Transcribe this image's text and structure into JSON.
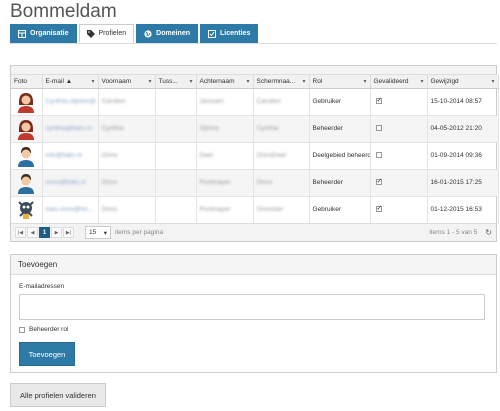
{
  "page": {
    "title": "Bommeldam"
  },
  "tabs": [
    {
      "label": "Organisatie",
      "icon": "table-icon",
      "active": false
    },
    {
      "label": "Profielen",
      "icon": "tags-icon",
      "active": true
    },
    {
      "label": "Domeinen",
      "icon": "globe-icon",
      "active": false
    },
    {
      "label": "Licenties",
      "icon": "checkbox-edit-icon",
      "active": false
    }
  ],
  "grid": {
    "columns": [
      "Foto",
      "E-mail",
      "Voornaam",
      "Tuss...",
      "Achternaam",
      "Schermnaa...",
      "Rol",
      "Gevalideerd",
      "Gewijzigd"
    ],
    "sort_indicator": "▲",
    "rows": [
      {
        "email": "Cynthia.clijsten@...",
        "voornaam": "Carolien",
        "tuss": "",
        "achternaam": "Janssen",
        "schermnaam": "Carolien",
        "rol": "Gebruiker",
        "gevalideerd": true,
        "gewijzigd": "15-10-2014 08:57",
        "avatar": "female"
      },
      {
        "email": "cynthia@bats.nl",
        "voornaam": "Cynthia",
        "tuss": "",
        "achternaam": "Zijlstra",
        "schermnaam": "Cynthia",
        "rol": "Beheerder",
        "gevalideerd": false,
        "gewijzigd": "04-05-2012 21:20",
        "avatar": "female"
      },
      {
        "email": "info@bats.nl",
        "voornaam": "Onno",
        "tuss": "",
        "achternaam": "Deel",
        "schermnaam": "OnnoDeel",
        "rol": "Deelgebied beheerder",
        "gevalideerd": false,
        "gewijzigd": "01-09-2014 09:36",
        "avatar": "male"
      },
      {
        "email": "onno@bats.nl",
        "voornaam": "Onno",
        "tuss": "",
        "achternaam": "Postmayer",
        "schermnaam": "Onno",
        "rol": "Beheerder",
        "gevalideerd": true,
        "gewijzigd": "16-01-2015 17:25",
        "avatar": "male"
      },
      {
        "email": "bats.onno@ho...",
        "voornaam": "Onno",
        "tuss": "",
        "achternaam": "Postmayer",
        "schermnaam": "Onnoster",
        "rol": "Gebruiker",
        "gevalideerd": true,
        "gewijzigd": "01-12-2015 16:53",
        "avatar": "mascot"
      }
    ]
  },
  "pager": {
    "current_page": "1",
    "page_size": "15",
    "items_per_page_label": "items per pagina",
    "info": "items 1 - 5 van 5"
  },
  "add_panel": {
    "title": "Toevoegen",
    "email_label": "E-mailadressen",
    "email_value": "",
    "admin_role_label": "Beheerder rol",
    "admin_role_checked": false,
    "submit_label": "Toevoegen"
  },
  "footer": {
    "validate_all_label": "Alle profielen valideren"
  },
  "colors": {
    "accent": "#2d7aa7",
    "pager_active": "#1e5d88"
  }
}
